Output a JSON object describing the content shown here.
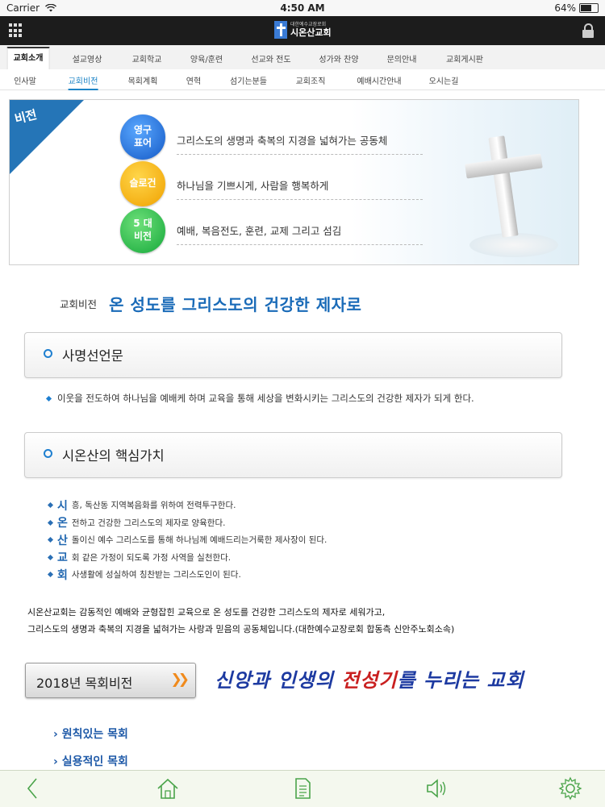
{
  "status": {
    "carrier": "Carrier",
    "time": "4:50 AM",
    "battery": "64%",
    "battery_level": 0.64
  },
  "header": {
    "logo_sub": "대한예수교장로회",
    "logo_main": "시온산교회"
  },
  "nav_main": [
    "교회소개",
    "설교영상",
    "교회학교",
    "양육/훈련",
    "선교와 전도",
    "성가와 찬양",
    "문의안내",
    "교회게시판"
  ],
  "nav_sub": [
    "인사말",
    "교회비전",
    "목회계획",
    "연혁",
    "섬기는분들",
    "교회조직",
    "예배시간안내",
    "오시는길"
  ],
  "banner": {
    "tag": "비전",
    "rows": [
      {
        "badge": "영구\n표어",
        "text": "그리스도의 생명과 축복의 지경을 넓혀가는 공동체",
        "color": "#1459c6"
      },
      {
        "badge": "슬로건",
        "text": "하나님을 기쁘시게, 사람을 행복하게",
        "color": "#f0a100"
      },
      {
        "badge": "5 대\n비전",
        "text": "예배, 복음전도, 훈련, 교제 그리고 섬김",
        "color": "#15a83a"
      }
    ]
  },
  "vision": {
    "label": "교회비전",
    "text": "온 성도를 그리스도의 건강한 제자로"
  },
  "mission": {
    "title": "사명선언문",
    "text": "이웃을 전도하여 하나님을 예배케 하며 교육을 통해 세상을 변화시키는 그리스도의 건강한 제자가 되게 한다."
  },
  "core": {
    "title": "시온산의 핵심가치",
    "items": [
      {
        "key": "시",
        "text": "흥, 독산동 지역복음화를 위하여 전력투구한다."
      },
      {
        "key": "온",
        "text": "전하고 건강한 그리스도의 제자로 양육한다."
      },
      {
        "key": "산",
        "text": "돌이신 예수 그리스도를 통해 하나님께 예배드리는거룩한 제사장이 된다."
      },
      {
        "key": "교",
        "text": "회 같은 가정이 되도록 가정 사역을 실천한다."
      },
      {
        "key": "회",
        "text": "사생활에 성실하여 칭찬받는 그리스도인이 된다."
      }
    ]
  },
  "summary": {
    "line1": "시온산교회는 감동적인 예배와 균형잡힌 교육으로 온 성도를 건강한 그리스도의 제자로 세워가고,",
    "line2": "그리스도의 생명과 축복의 지경을 넓혀가는 사랑과 믿음의 공동체입니다.(대한예수교장로회 합동측 신안주노회소속)"
  },
  "pastoral": {
    "button": "2018년 목회비전",
    "slogan_a": "신앙과 인생의 ",
    "slogan_b": "전성기",
    "slogan_c": "를 누리는 교회",
    "links": [
      "원칙있는 목회",
      "실용적인 목회"
    ]
  },
  "colors": {
    "accent": "#1c84c6",
    "headline": "#1a6bb8",
    "orange": "#f08a1c",
    "tabbar_icon": "#4aa44a"
  },
  "icons": [
    "back-icon",
    "home-icon",
    "document-icon",
    "speaker-icon",
    "settings-icon"
  ]
}
